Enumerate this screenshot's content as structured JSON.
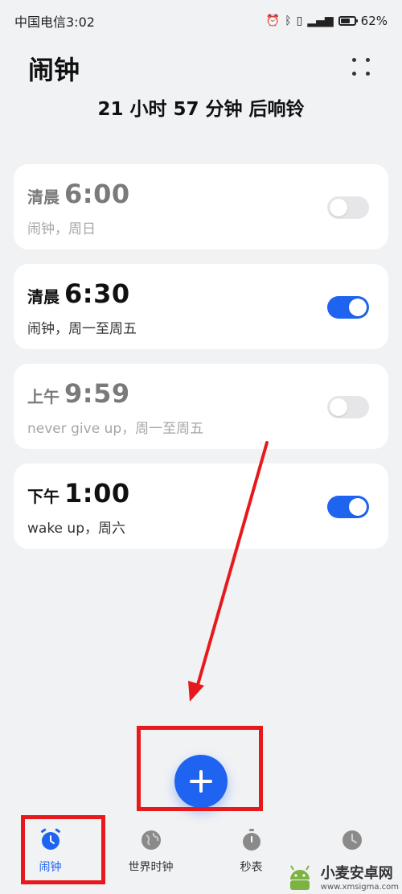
{
  "status_bar": {
    "carrier_time": "中国电信3:02",
    "battery": "62%"
  },
  "header": {
    "title": "闹钟",
    "countdown": "21 小时 57 分钟 后响铃"
  },
  "alarms": [
    {
      "period": "清晨",
      "time": "6:00",
      "desc": "闹钟，周日",
      "enabled": false
    },
    {
      "period": "清晨",
      "time": "6:30",
      "desc": "闹钟，周一至周五",
      "enabled": true
    },
    {
      "period": "上午",
      "time": "9:59",
      "desc": "never  give  up，周一至周五",
      "enabled": false
    },
    {
      "period": "下午",
      "time": "1:00",
      "desc": "wake up，周六",
      "enabled": true
    }
  ],
  "bottom_nav": [
    {
      "label": "闹钟",
      "icon": "alarm-clock-icon",
      "active": true
    },
    {
      "label": "世界时钟",
      "icon": "globe-icon",
      "active": false
    },
    {
      "label": "秒表",
      "icon": "stopwatch-icon",
      "active": false
    },
    {
      "label": "",
      "icon": "timer-icon",
      "active": false
    }
  ],
  "watermark": {
    "title": "小麦安卓网",
    "url": "www.xmsigma.com"
  },
  "colors": {
    "accent": "#1f64f0",
    "annotation": "#e8191c",
    "background": "#f1f2f4"
  }
}
